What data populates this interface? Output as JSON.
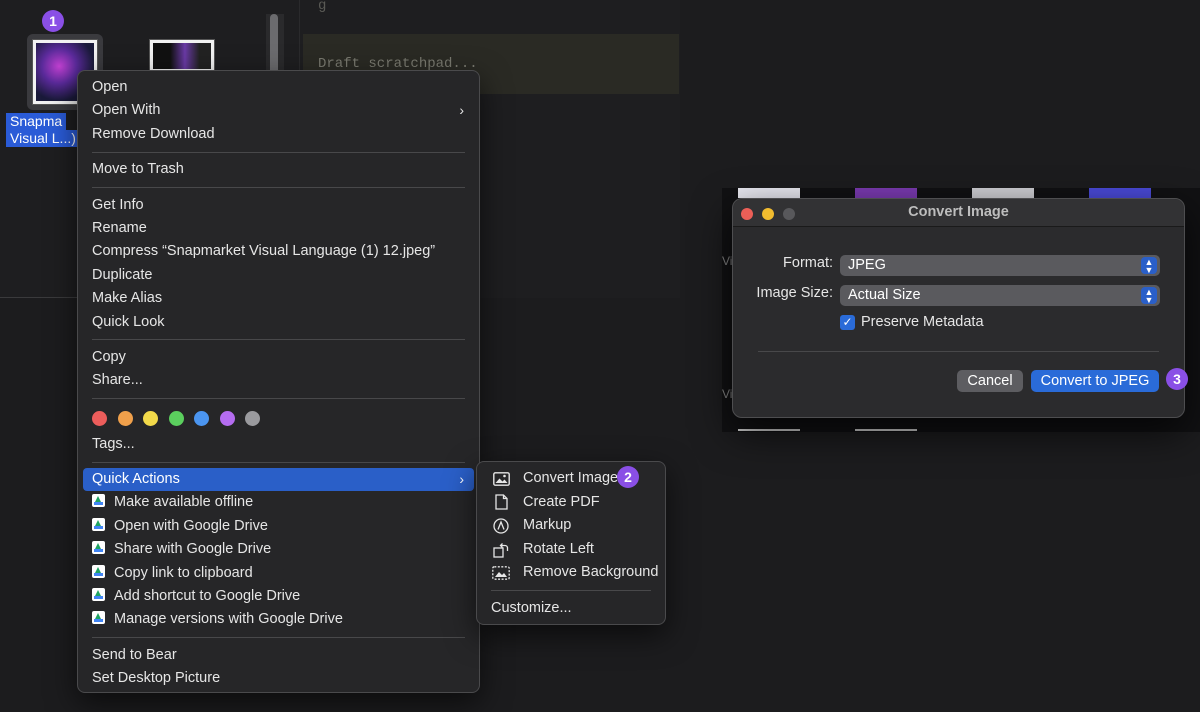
{
  "finder": {
    "file_label_line1": "Snapma",
    "file_label_line2": "Visual L...)"
  },
  "scratchpad": {
    "placeholder": "Draft scratchpad..."
  },
  "badges": {
    "b1": "1",
    "b2": "2",
    "b3": "3"
  },
  "gallery": {
    "vis1": "Vis",
    "vis2": "Vis"
  },
  "context_menu": {
    "open": "Open",
    "open_with": "Open With",
    "remove_download": "Remove Download",
    "move_to_trash": "Move to Trash",
    "get_info": "Get Info",
    "rename": "Rename",
    "compress": "Compress “Snapmarket Visual Language (1) 12.jpeg”",
    "duplicate": "Duplicate",
    "make_alias": "Make Alias",
    "quick_look": "Quick Look",
    "copy": "Copy",
    "share": "Share...",
    "tag_colors": [
      "#ec5d5b",
      "#f0a04b",
      "#f2d94a",
      "#5bcf5e",
      "#4b95f0",
      "#b46cf0",
      "#9a9a9e"
    ],
    "tags": "Tags...",
    "quick_actions": "Quick Actions",
    "gd_items": [
      "Make available offline",
      "Open with Google Drive",
      "Share with Google Drive",
      "Copy link to clipboard",
      "Add shortcut to Google Drive",
      "Manage versions with Google Drive"
    ],
    "send_to_bear": "Send to Bear",
    "set_desktop_picture": "Set Desktop Picture"
  },
  "submenu": {
    "convert_image": "Convert Image",
    "create_pdf": "Create PDF",
    "markup": "Markup",
    "rotate_left": "Rotate Left",
    "remove_background": "Remove Background",
    "customize": "Customize..."
  },
  "dialog": {
    "title": "Convert Image",
    "format_label": "Format:",
    "format_value": "JPEG",
    "image_size_label": "Image Size:",
    "image_size_value": "Actual Size",
    "preserve_metadata": "Preserve Metadata",
    "cancel": "Cancel",
    "convert": "Convert to JPEG"
  },
  "colors": {
    "accent": "#2a5fc8",
    "badge": "#8a4fe6"
  }
}
